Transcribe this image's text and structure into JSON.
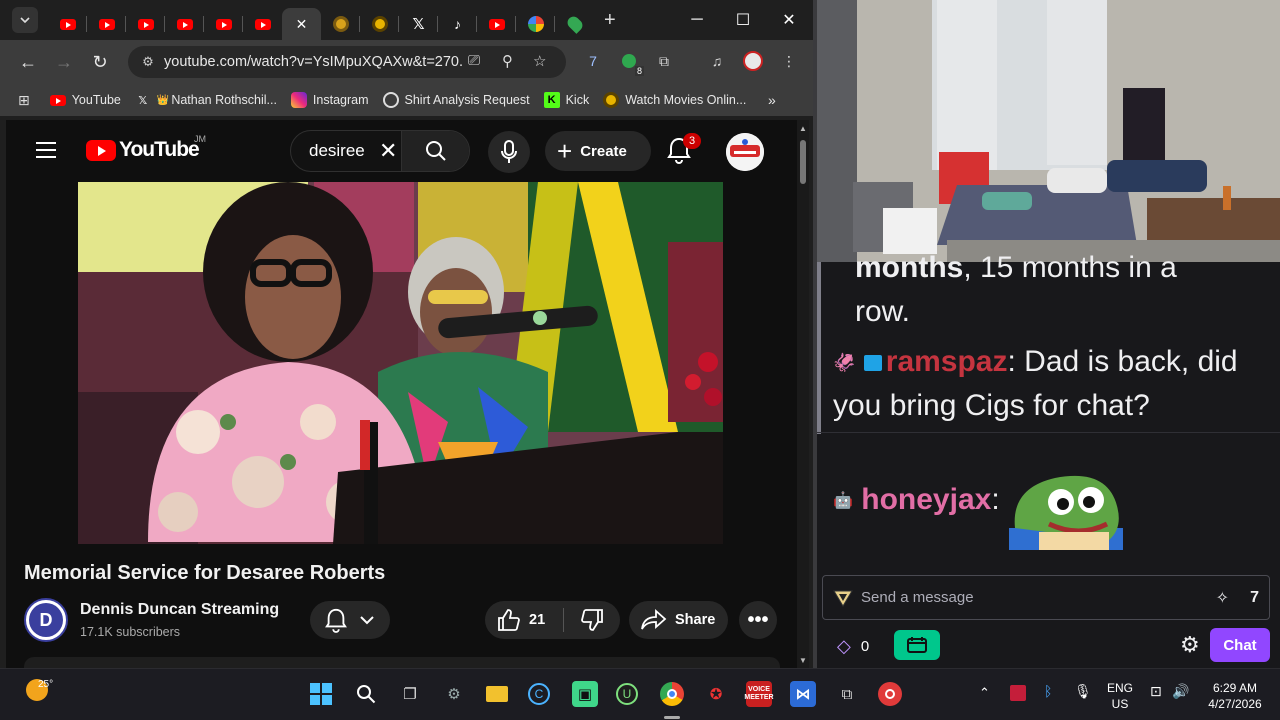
{
  "browser": {
    "url": "youtube.com/watch?v=YsIMpuXQAXw&t=270...",
    "extension_badge": "8",
    "bookmarks": [
      {
        "label": "YouTube",
        "icon": "youtube-icon"
      },
      {
        "label": "Nathan Rothschil...",
        "icon": "x-icon"
      },
      {
        "label": "Instagram",
        "icon": "instagram-icon"
      },
      {
        "label": "Shirt Analysis Request",
        "icon": "openai-icon"
      },
      {
        "label": "Kick",
        "icon": "kick-icon"
      },
      {
        "label": "Watch Movies Onlin...",
        "icon": "movie-icon"
      }
    ],
    "more_bookmarks": "»"
  },
  "youtube": {
    "logo_text": "YouTube",
    "country_code": "JM",
    "search_value": "desiree",
    "create_label": "Create",
    "notification_count": "3",
    "video_title": "Memorial Service for Desaree Roberts",
    "channel_name": "Dennis Duncan Streaming",
    "channel_initial": "D",
    "subscribers": "17.1K subscribers",
    "like_count": "21",
    "share_label": "Share"
  },
  "chat": {
    "messages": [
      {
        "bold_fragment": "months",
        "text": ", 15 months in a",
        "text2": "row."
      },
      {
        "user": "ramspaz",
        "text": ": Dad is back, did",
        "text2": "you bring Cigs for chat?"
      },
      {
        "user": "honeyjax",
        "text": ":"
      }
    ],
    "input_placeholder": "Send a message",
    "points": "0",
    "chat_button": "Chat",
    "colors": {
      "ramspaz": "#c5343f",
      "honeyjax": "#e26ea6",
      "accent": "#9147ff"
    }
  },
  "taskbar": {
    "temperature": "25°",
    "language": "ENG",
    "region": "US",
    "time": "6:29 AM",
    "date": "4/27/2026",
    "voicemeeter_label": "VOICE MEETER"
  }
}
